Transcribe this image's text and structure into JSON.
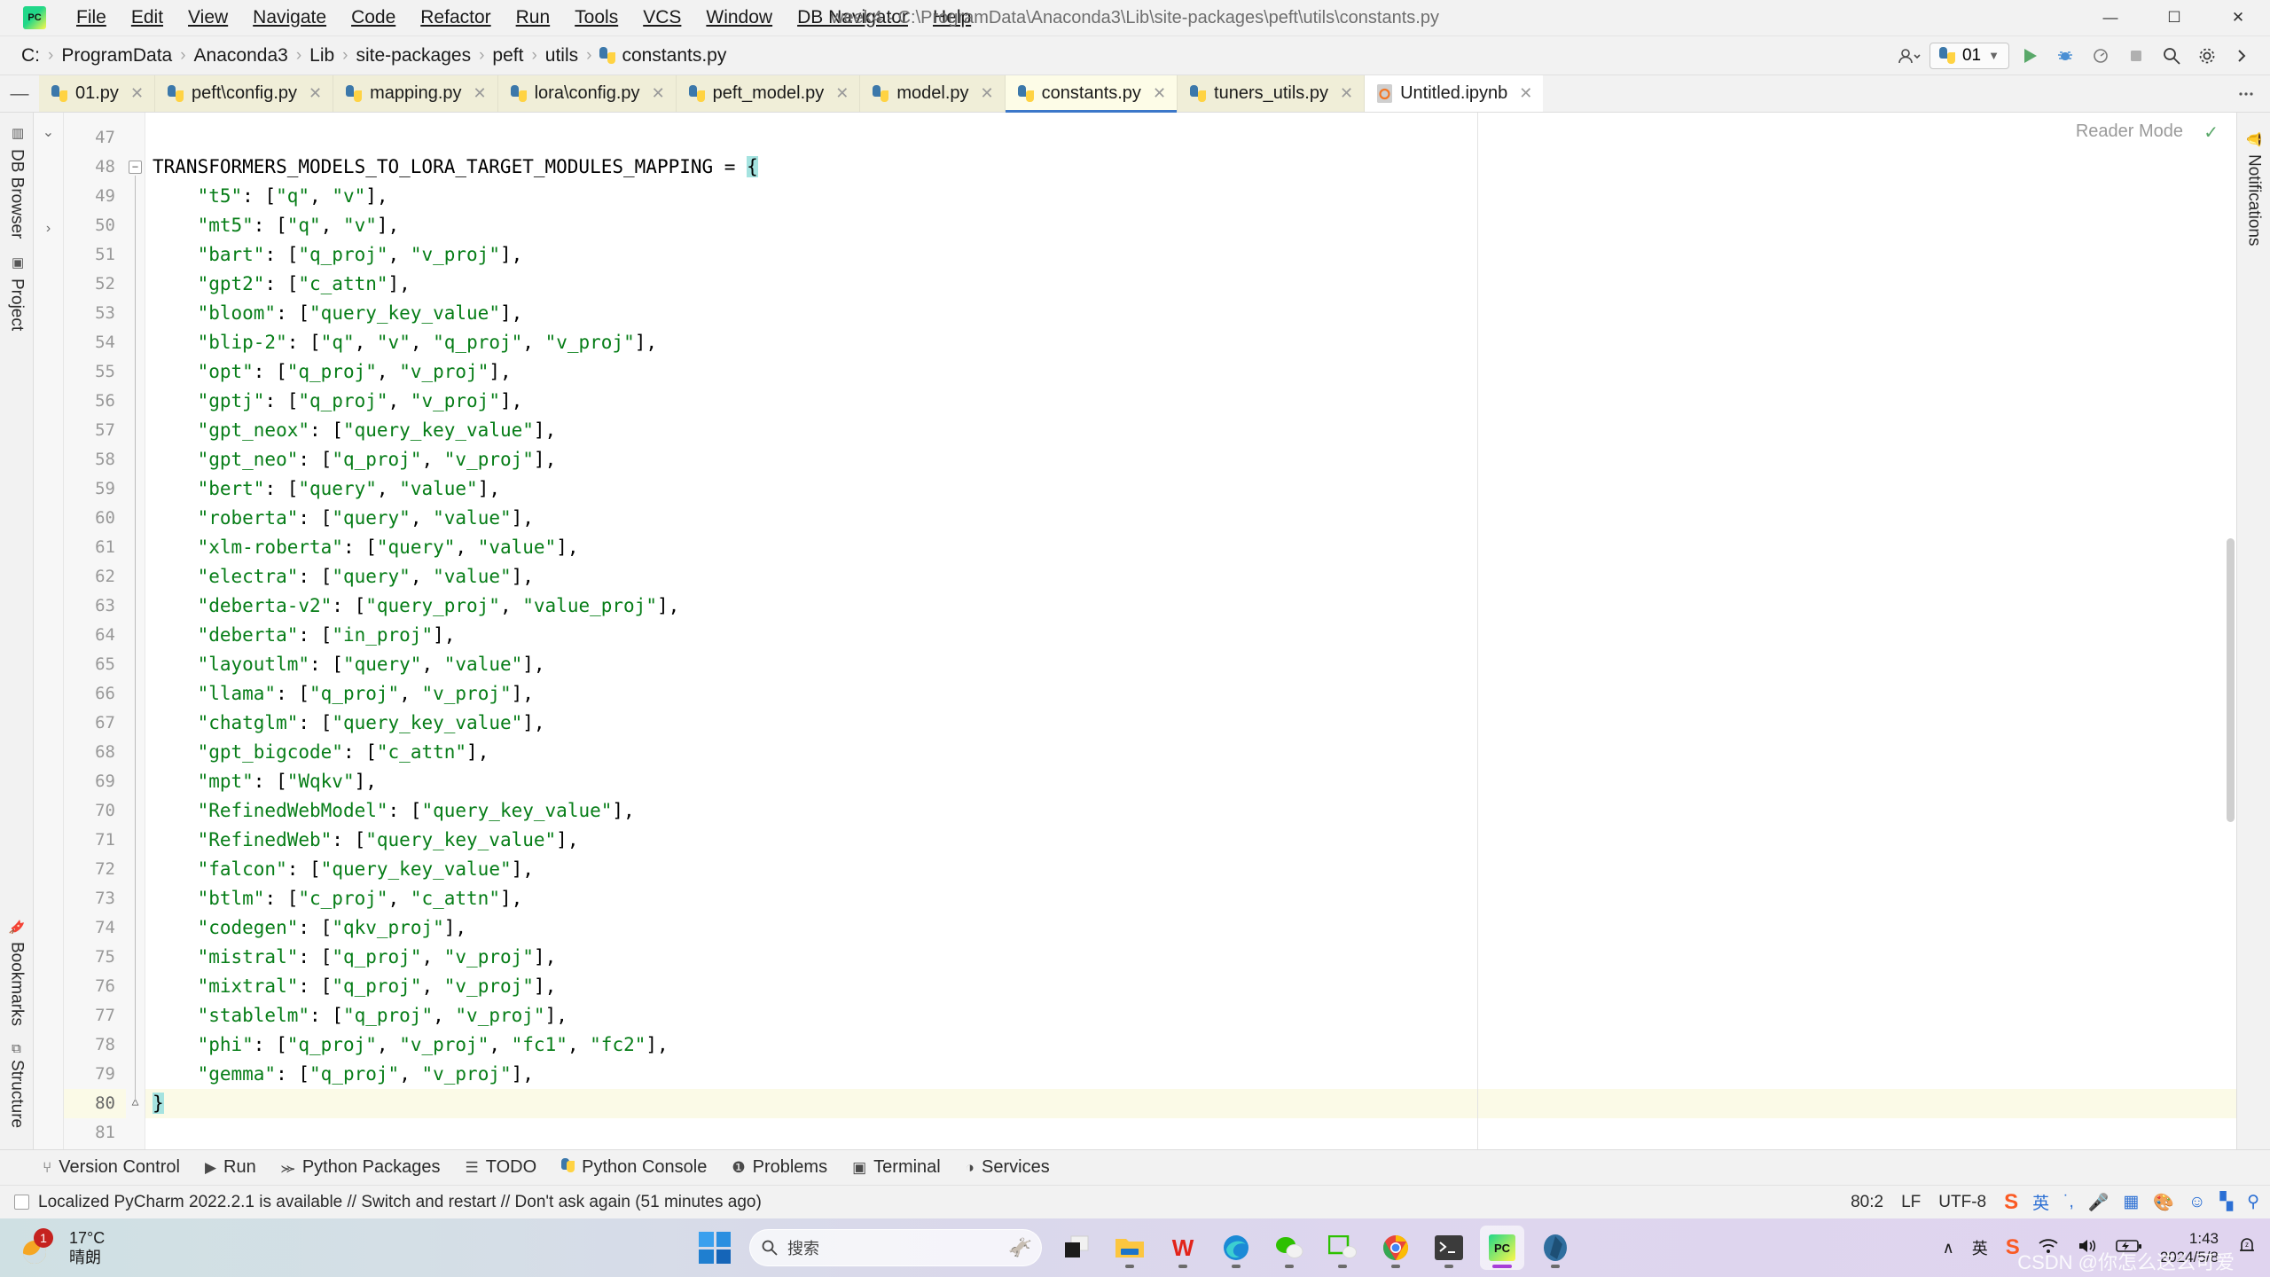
{
  "titlebar": {
    "logo": "pycharm-logo",
    "window_title": "week4 - C:\\ProgramData\\Anaconda3\\Lib\\site-packages\\peft\\utils\\constants.py",
    "menus": [
      "File",
      "Edit",
      "View",
      "Navigate",
      "Code",
      "Refactor",
      "Run",
      "Tools",
      "VCS",
      "Window",
      "DB Navigator",
      "Help"
    ],
    "minimize": "—",
    "maximize": "☐",
    "close": "✕"
  },
  "navbar": {
    "crumbs": [
      "C:",
      "ProgramData",
      "Anaconda3",
      "Lib",
      "site-packages",
      "peft",
      "utils",
      "constants.py"
    ],
    "separator": "›",
    "run_config": "01",
    "actions": [
      "run",
      "debug",
      "profile",
      "stop",
      "search",
      "settings",
      "more"
    ]
  },
  "tabs": [
    {
      "label": "01.py",
      "icon": "python-file-icon",
      "active": false
    },
    {
      "label": "peft\\config.py",
      "icon": "python-file-icon",
      "active": false
    },
    {
      "label": "mapping.py",
      "icon": "python-file-icon",
      "active": false
    },
    {
      "label": "lora\\config.py",
      "icon": "python-file-icon",
      "active": false
    },
    {
      "label": "peft_model.py",
      "icon": "python-file-icon",
      "active": false
    },
    {
      "label": "model.py",
      "icon": "python-file-icon",
      "active": false
    },
    {
      "label": "constants.py",
      "icon": "python-file-icon",
      "active": true
    },
    {
      "label": "tuners_utils.py",
      "icon": "python-file-icon",
      "active": false
    },
    {
      "label": "Untitled.ipynb",
      "icon": "jupyter-file-icon",
      "active": false
    }
  ],
  "left_sidebar": {
    "items": [
      "DB Browser",
      "Project",
      "Bookmarks",
      "Structure"
    ]
  },
  "right_sidebar": {
    "items": [
      "Notifications"
    ]
  },
  "editor": {
    "reader_mode_label": "Reader Mode",
    "reader_mode_check": "✓",
    "first_visible_line": 47,
    "cursor_line": 80,
    "lines": [
      {
        "n": 47,
        "text": ""
      },
      {
        "n": 48,
        "text": "TRANSFORMERS_MODELS_TO_LORA_TARGET_MODULES_MAPPING = {"
      },
      {
        "n": 49,
        "text": "    \"t5\": [\"q\", \"v\"],"
      },
      {
        "n": 50,
        "text": "    \"mt5\": [\"q\", \"v\"],"
      },
      {
        "n": 51,
        "text": "    \"bart\": [\"q_proj\", \"v_proj\"],"
      },
      {
        "n": 52,
        "text": "    \"gpt2\": [\"c_attn\"],"
      },
      {
        "n": 53,
        "text": "    \"bloom\": [\"query_key_value\"],"
      },
      {
        "n": 54,
        "text": "    \"blip-2\": [\"q\", \"v\", \"q_proj\", \"v_proj\"],"
      },
      {
        "n": 55,
        "text": "    \"opt\": [\"q_proj\", \"v_proj\"],"
      },
      {
        "n": 56,
        "text": "    \"gptj\": [\"q_proj\", \"v_proj\"],"
      },
      {
        "n": 57,
        "text": "    \"gpt_neox\": [\"query_key_value\"],"
      },
      {
        "n": 58,
        "text": "    \"gpt_neo\": [\"q_proj\", \"v_proj\"],"
      },
      {
        "n": 59,
        "text": "    \"bert\": [\"query\", \"value\"],"
      },
      {
        "n": 60,
        "text": "    \"roberta\": [\"query\", \"value\"],"
      },
      {
        "n": 61,
        "text": "    \"xlm-roberta\": [\"query\", \"value\"],"
      },
      {
        "n": 62,
        "text": "    \"electra\": [\"query\", \"value\"],"
      },
      {
        "n": 63,
        "text": "    \"deberta-v2\": [\"query_proj\", \"value_proj\"],"
      },
      {
        "n": 64,
        "text": "    \"deberta\": [\"in_proj\"],"
      },
      {
        "n": 65,
        "text": "    \"layoutlm\": [\"query\", \"value\"],"
      },
      {
        "n": 66,
        "text": "    \"llama\": [\"q_proj\", \"v_proj\"],"
      },
      {
        "n": 67,
        "text": "    \"chatglm\": [\"query_key_value\"],"
      },
      {
        "n": 68,
        "text": "    \"gpt_bigcode\": [\"c_attn\"],"
      },
      {
        "n": 69,
        "text": "    \"mpt\": [\"Wqkv\"],"
      },
      {
        "n": 70,
        "text": "    \"RefinedWebModel\": [\"query_key_value\"],"
      },
      {
        "n": 71,
        "text": "    \"RefinedWeb\": [\"query_key_value\"],"
      },
      {
        "n": 72,
        "text": "    \"falcon\": [\"query_key_value\"],"
      },
      {
        "n": 73,
        "text": "    \"btlm\": [\"c_proj\", \"c_attn\"],"
      },
      {
        "n": 74,
        "text": "    \"codegen\": [\"qkv_proj\"],"
      },
      {
        "n": 75,
        "text": "    \"mistral\": [\"q_proj\", \"v_proj\"],"
      },
      {
        "n": 76,
        "text": "    \"mixtral\": [\"q_proj\", \"v_proj\"],"
      },
      {
        "n": 77,
        "text": "    \"stablelm\": [\"q_proj\", \"v_proj\"],"
      },
      {
        "n": 78,
        "text": "    \"phi\": [\"q_proj\", \"v_proj\", \"fc1\", \"fc2\"],"
      },
      {
        "n": 79,
        "text": "    \"gemma\": [\"q_proj\", \"v_proj\"],"
      },
      {
        "n": 80,
        "text": "}"
      },
      {
        "n": 81,
        "text": ""
      }
    ]
  },
  "bottom_tools": [
    {
      "label": "Version Control",
      "icon": "branch-icon"
    },
    {
      "label": "Run",
      "icon": "play-icon"
    },
    {
      "label": "Python Packages",
      "icon": "packages-icon"
    },
    {
      "label": "TODO",
      "icon": "list-icon"
    },
    {
      "label": "Python Console",
      "icon": "python-icon"
    },
    {
      "label": "Problems",
      "icon": "warning-icon"
    },
    {
      "label": "Terminal",
      "icon": "terminal-icon"
    },
    {
      "label": "Services",
      "icon": "services-icon"
    }
  ],
  "statusbar": {
    "message": "Localized PyCharm 2022.2.1 is available // Switch and restart // Don't ask again (51 minutes ago)",
    "caret": "80:2",
    "line_separator": "LF",
    "encoding": "UTF-8",
    "tray": [
      "sogou-icon",
      "英",
      "punctuation-icon",
      "mic-icon",
      "keyboard-icon",
      "skin-icon",
      "emoji-icon",
      "apps-icon",
      "pin-icon"
    ]
  },
  "taskbar": {
    "weather": {
      "temp": "17°C",
      "condition": "晴朗",
      "badge": "1"
    },
    "search_placeholder": "搜索",
    "apps": [
      "start-icon",
      "search-box",
      "task-view-icon",
      "file-explorer-icon",
      "wps-icon",
      "edge-icon",
      "wechat-icon",
      "wechat-devtools-icon",
      "chrome-icon",
      "terminal-icon",
      "pycharm-icon",
      "obsidian-icon"
    ],
    "tray_up": "∧",
    "ime": "英",
    "sogou": "S",
    "wifi": "wifi-icon",
    "volume": "volume-icon",
    "battery": "battery-charging-icon",
    "time": "1:43",
    "date": "2024/5/8",
    "notification": "notification-bell-icon",
    "watermark": "CSDN @你怎么这么可爱"
  },
  "colors": {
    "accent": "#3c77c9",
    "string": "#067d17",
    "keyword": "#0033b3",
    "tab_active_bg": "#fdfce7",
    "tab_bg": "#f0eed8",
    "chrome": "#f2f2f2",
    "caret_hl": "#a5e3e0"
  }
}
